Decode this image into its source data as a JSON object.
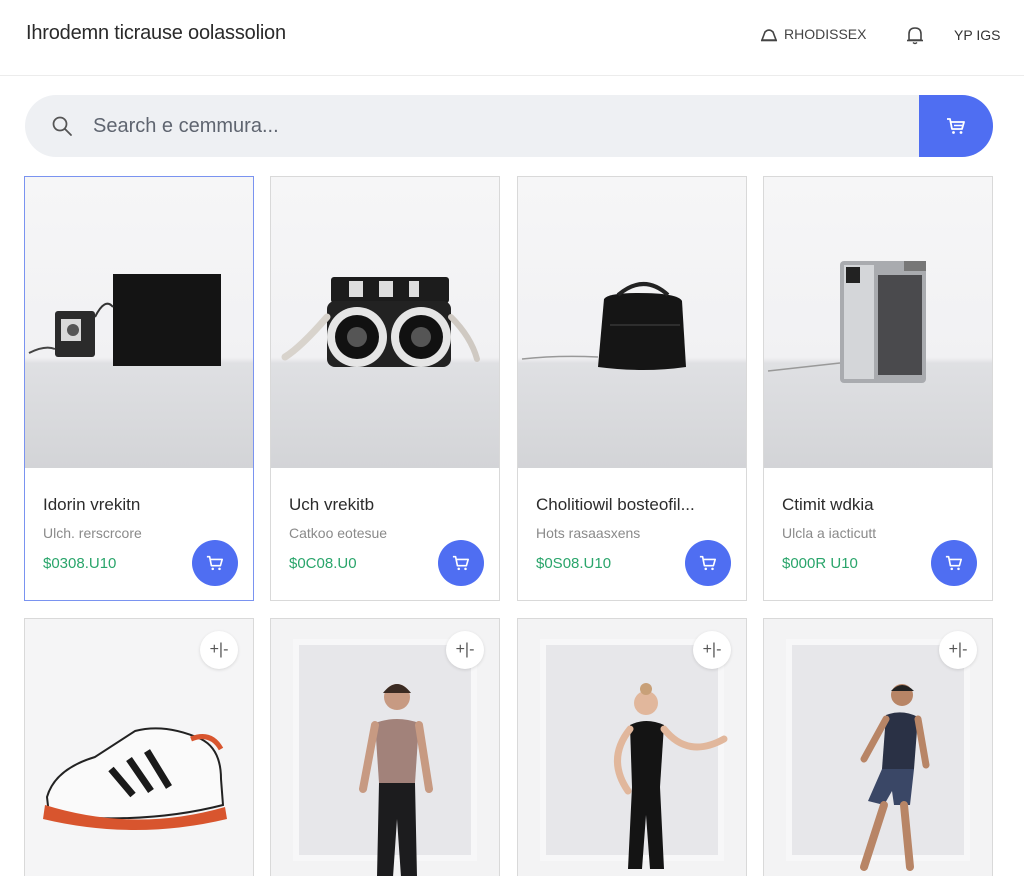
{
  "header": {
    "title": "Ihrodemn ticrause oolassolion",
    "account_label": "RHODISSEX",
    "right_label": "YP IGS"
  },
  "search": {
    "placeholder": "Search e cemmura..."
  },
  "products": [
    {
      "name": "Idorin vrekitn",
      "subtitle": "Ulch. rerscrcore",
      "price": "$0308.U10",
      "image": "camera-kit-with-black-box"
    },
    {
      "name": "Uch vrekitb",
      "subtitle": "Catkoo eotesue",
      "price": "$0C08.U0",
      "image": "twin-lens-camera"
    },
    {
      "name": "Cholitiowil bosteofil...",
      "subtitle": "Hots rasaasxens",
      "price": "$0S08.U10",
      "image": "black-bag"
    },
    {
      "name": "Ctimit wdkia",
      "subtitle": "Ulcla a iacticutt",
      "price": "$000R U10",
      "image": "silver-instant-camera"
    }
  ],
  "products_row2": [
    {
      "image": "sneaker",
      "add_label": "+|-"
    },
    {
      "image": "model-tank-top-leggings",
      "add_label": "+|-"
    },
    {
      "image": "model-black-activewear",
      "add_label": "+|-"
    },
    {
      "image": "model-shorts-tee",
      "add_label": "+|-"
    }
  ],
  "colors": {
    "accent": "#4f6ef2",
    "price": "#2aa56b",
    "search_bg": "#eef0f3"
  }
}
